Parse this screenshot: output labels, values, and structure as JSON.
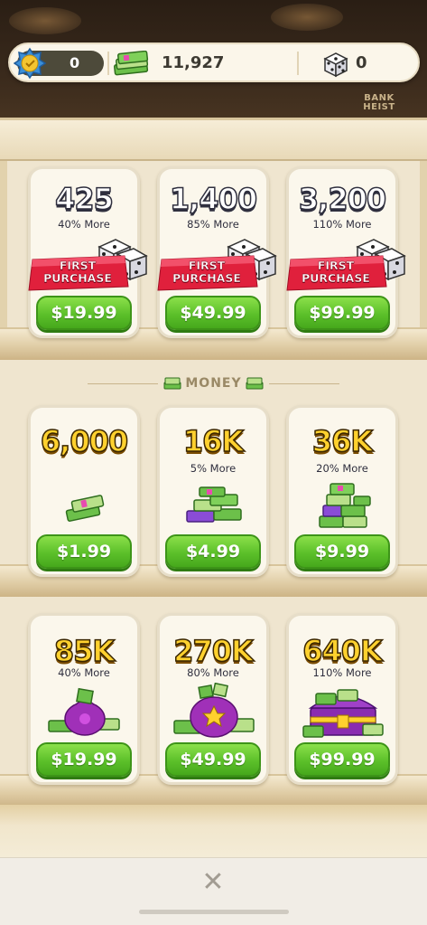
{
  "topbar": {
    "badge_count": "0",
    "cash_amount": "11,927",
    "dice_count": "0"
  },
  "brand_logo": "BANK HEIST",
  "dice_offers": [
    {
      "amount": "425",
      "bonus": "40% More",
      "banner": "FIRST PURCHASE",
      "price": "$19.99"
    },
    {
      "amount": "1,400",
      "bonus": "85% More",
      "banner": "FIRST PURCHASE",
      "price": "$49.99"
    },
    {
      "amount": "3,200",
      "bonus": "110% More",
      "banner": "FIRST PURCHASE",
      "price": "$99.99"
    }
  ],
  "money_section": {
    "title": "MONEY"
  },
  "money_offers_row1": [
    {
      "amount": "6,000",
      "bonus": "",
      "price": "$1.99"
    },
    {
      "amount": "16K",
      "bonus": "5% More",
      "price": "$4.99"
    },
    {
      "amount": "36K",
      "bonus": "20% More",
      "price": "$9.99"
    }
  ],
  "money_offers_row2": [
    {
      "amount": "85K",
      "bonus": "40% More",
      "price": "$19.99"
    },
    {
      "amount": "270K",
      "bonus": "80% More",
      "price": "$49.99"
    },
    {
      "amount": "640K",
      "bonus": "110% More",
      "price": "$99.99"
    }
  ],
  "footer": {
    "close_symbol": "✕"
  },
  "colors": {
    "price_button": "#5cc02a",
    "banner_red": "#e0203c",
    "gold_text": "#ffd12e"
  }
}
